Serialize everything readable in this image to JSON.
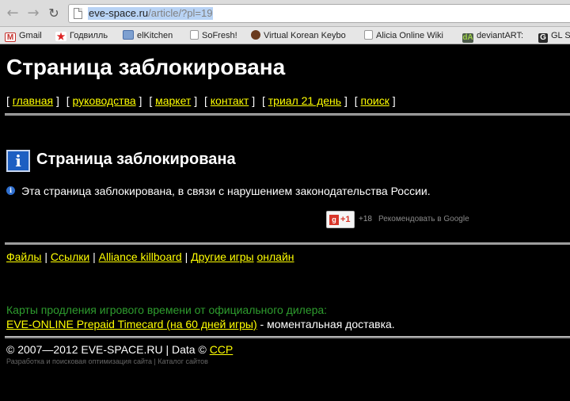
{
  "browser": {
    "url_host": "eve-space.ru",
    "url_path": "/article/?pl=19",
    "bookmarks": [
      {
        "label": "Gmail",
        "icon": "gmail-icon",
        "glyph": "M"
      },
      {
        "label": "Годвилль",
        "icon": "godville-icon",
        "glyph": "★"
      },
      {
        "label": "elKitchen",
        "icon": "folder-icon",
        "glyph": ""
      },
      {
        "label": "SoFresh!",
        "icon": "page-icon",
        "glyph": ""
      },
      {
        "label": "Virtual Korean Keybo",
        "icon": "feather-icon",
        "glyph": ""
      },
      {
        "label": "Alicia Online Wiki",
        "icon": "page-icon",
        "glyph": ""
      },
      {
        "label": "deviantART:",
        "icon": "deviantart-icon",
        "glyph": "dA"
      },
      {
        "label": "GL S",
        "icon": "gl-icon",
        "glyph": "G"
      }
    ]
  },
  "page": {
    "site_title": "Страница заблокирована",
    "top_nav": [
      {
        "label": "главная"
      },
      {
        "label": "руководства"
      },
      {
        "label": "маркет"
      },
      {
        "label": "контакт"
      },
      {
        "label": "триал 21 день"
      },
      {
        "label": "поиск"
      }
    ],
    "block_title": "Страница заблокирована",
    "block_message": "Эта страница заблокирована, в связи с нарушением законодательства России.",
    "gplus": {
      "button_label": "+1",
      "count": "+18",
      "recommend": "Рекомендовать в Google"
    },
    "secondary_nav": {
      "files": "Файлы",
      "links": "Ссылки",
      "killboard": "Alliance killboard",
      "other_games": "Другие игры",
      "online": "онлайн"
    },
    "promo": {
      "label": "Карты продления игрового времени от официального дилера:",
      "link": "EVE-ONLINE Prepaid Timecard (на 60 дней игры)",
      "suffix": " - моментальная доставка."
    },
    "footer": {
      "copyright_prefix": "© 2007—2012 EVE-SPACE.RU | Data © ",
      "ccp": "CCP",
      "small": "Разработка и поисковая оптимизация сайта | Каталог сайтов"
    }
  },
  "colors": {
    "background": "#000000",
    "link": "#ffff00",
    "promo_label": "#2e9d2e",
    "info_icon": "#1d5fc2"
  }
}
